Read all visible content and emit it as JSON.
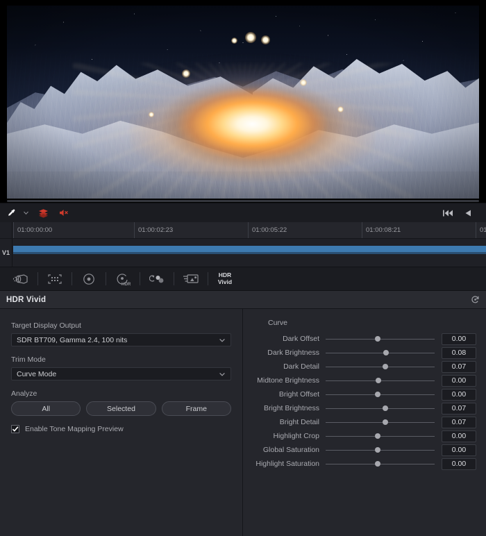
{
  "viewer": {
    "toolbar": {
      "eyedropper_icon": "eyedropper-icon",
      "chevron_icon": "chevron-down-icon",
      "layers_icon": "stacked-layers-icon",
      "mute_icon": "speaker-muted-icon",
      "skip_start_icon": "skip-to-start-icon",
      "reverse_play_icon": "reverse-play-icon"
    }
  },
  "timeline": {
    "ruler_ticks": [
      "01:00:00:00",
      "01:00:02:23",
      "01:00:05:22",
      "01:00:08:21",
      "01"
    ],
    "track_label": "V1"
  },
  "palette_bar": {
    "items": [
      {
        "name": "camera-raw-icon",
        "label": ""
      },
      {
        "name": "color-match-icon",
        "label": ""
      },
      {
        "name": "color-warper-icon",
        "label": ""
      },
      {
        "name": "hdr-wheels-icon",
        "label": ""
      },
      {
        "name": "primaries-icon",
        "label": ""
      },
      {
        "name": "color-slice-icon",
        "label": ""
      }
    ],
    "hdr_vivid_label_line1": "HDR",
    "hdr_vivid_label_line2": "Vivid"
  },
  "panel": {
    "title": "HDR Vivid",
    "reset_icon": "reset-icon"
  },
  "left_pane": {
    "target_display_output": {
      "label": "Target Display Output",
      "value": "SDR BT709, Gamma 2.4, 100 nits",
      "chevron_icon": "chevron-down-icon"
    },
    "trim_mode": {
      "label": "Trim Mode",
      "value": "Curve Mode",
      "chevron_icon": "chevron-down-icon"
    },
    "analyze": {
      "label": "Analyze",
      "buttons": [
        "All",
        "Selected",
        "Frame"
      ]
    },
    "tone_mapping": {
      "label": "Enable Tone Mapping Preview",
      "checked": true,
      "check_icon": "checkmark-icon"
    }
  },
  "right_pane": {
    "curve_title": "Curve",
    "sliders": [
      {
        "label": "Dark Offset",
        "value": "0.00",
        "pos": 48.0
      },
      {
        "label": "Dark Brightness",
        "value": "0.08",
        "pos": 55.5
      },
      {
        "label": "Dark Detail",
        "value": "0.07",
        "pos": 54.5
      },
      {
        "label": "Midtone Brightness",
        "value": "0.00",
        "pos": 48.5
      },
      {
        "label": "Bright Offset",
        "value": "0.00",
        "pos": 48.0
      },
      {
        "label": "Bright Brightness",
        "value": "0.07",
        "pos": 54.5
      },
      {
        "label": "Bright Detail",
        "value": "0.07",
        "pos": 54.5
      },
      {
        "label": "Highlight Crop",
        "value": "0.00",
        "pos": 48.0
      },
      {
        "label": "Global Saturation",
        "value": "0.00",
        "pos": 48.0
      },
      {
        "label": "Highlight Saturation",
        "value": "0.00",
        "pos": 48.0
      }
    ]
  },
  "colors": {
    "panel_bg": "#25262c",
    "toolbar_bg": "#1b1c21",
    "header_bg": "#2a2b31",
    "clip_blue": "#3d7ab0",
    "accent_red": "#c0392b"
  }
}
